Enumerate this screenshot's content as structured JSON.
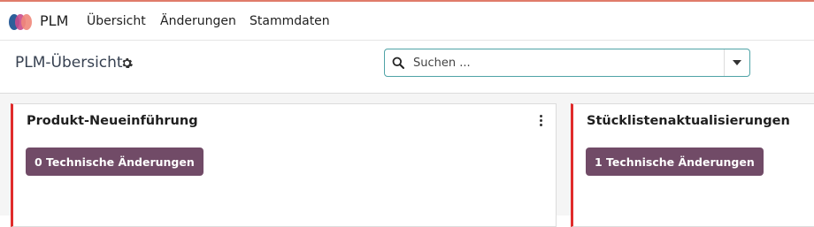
{
  "app": {
    "name": "PLM",
    "menu": [
      "Übersicht",
      "Änderungen",
      "Stammdaten"
    ]
  },
  "control_panel": {
    "title": "PLM-Übersicht",
    "search": {
      "placeholder": "Suchen ..."
    }
  },
  "colors": {
    "accent": "#714b67",
    "card_border": "#e02b2b",
    "search_border": "#4fa3a6"
  },
  "kanban": {
    "cards": [
      {
        "title": "Produkt-Neueinführung",
        "button_label": "0 Technische Änderungen"
      },
      {
        "title": "Stücklistenaktualisierungen",
        "button_label": "1 Technische Änderungen"
      }
    ]
  }
}
